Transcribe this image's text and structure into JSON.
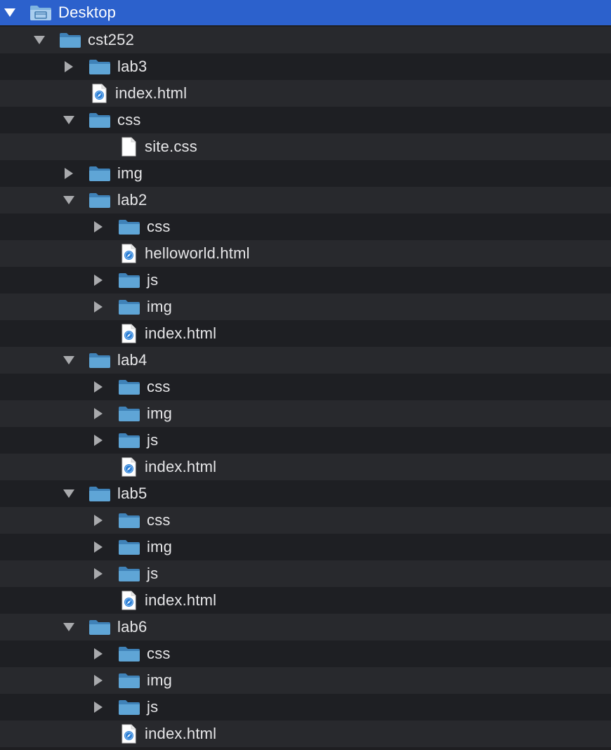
{
  "colors": {
    "selected_row": "#2c61cc",
    "row_odd": "#28292d",
    "row_even": "#1e1f23",
    "text": "#e6e6e8",
    "folder": "#5fa5d6",
    "disclosure": "#a9aaad"
  },
  "tree": [
    {
      "label": "Desktop",
      "depth": 0,
      "type": "desktop-folder",
      "state": "expanded",
      "selected": true
    },
    {
      "label": "cst252",
      "depth": 1,
      "type": "folder",
      "state": "expanded"
    },
    {
      "label": "lab3",
      "depth": 2,
      "type": "folder",
      "state": "collapsed"
    },
    {
      "label": "index.html",
      "depth": 2,
      "type": "html-file",
      "state": "none"
    },
    {
      "label": "css",
      "depth": 2,
      "type": "folder",
      "state": "expanded"
    },
    {
      "label": "site.css",
      "depth": 3,
      "type": "css-file",
      "state": "none"
    },
    {
      "label": "img",
      "depth": 2,
      "type": "folder",
      "state": "collapsed"
    },
    {
      "label": "lab2",
      "depth": 2,
      "type": "folder",
      "state": "expanded"
    },
    {
      "label": "css",
      "depth": 3,
      "type": "folder",
      "state": "collapsed"
    },
    {
      "label": "helloworld.html",
      "depth": 3,
      "type": "html-file",
      "state": "none"
    },
    {
      "label": "js",
      "depth": 3,
      "type": "folder",
      "state": "collapsed"
    },
    {
      "label": "img",
      "depth": 3,
      "type": "folder",
      "state": "collapsed"
    },
    {
      "label": "index.html",
      "depth": 3,
      "type": "html-file",
      "state": "none"
    },
    {
      "label": "lab4",
      "depth": 2,
      "type": "folder",
      "state": "expanded"
    },
    {
      "label": "css",
      "depth": 3,
      "type": "folder",
      "state": "collapsed"
    },
    {
      "label": "img",
      "depth": 3,
      "type": "folder",
      "state": "collapsed"
    },
    {
      "label": "js",
      "depth": 3,
      "type": "folder",
      "state": "collapsed"
    },
    {
      "label": "index.html",
      "depth": 3,
      "type": "html-file",
      "state": "none"
    },
    {
      "label": "lab5",
      "depth": 2,
      "type": "folder",
      "state": "expanded"
    },
    {
      "label": "css",
      "depth": 3,
      "type": "folder",
      "state": "collapsed"
    },
    {
      "label": "img",
      "depth": 3,
      "type": "folder",
      "state": "collapsed"
    },
    {
      "label": "js",
      "depth": 3,
      "type": "folder",
      "state": "collapsed"
    },
    {
      "label": "index.html",
      "depth": 3,
      "type": "html-file",
      "state": "none"
    },
    {
      "label": "lab6",
      "depth": 2,
      "type": "folder",
      "state": "expanded"
    },
    {
      "label": "css",
      "depth": 3,
      "type": "folder",
      "state": "collapsed"
    },
    {
      "label": "img",
      "depth": 3,
      "type": "folder",
      "state": "collapsed"
    },
    {
      "label": "js",
      "depth": 3,
      "type": "folder",
      "state": "collapsed"
    },
    {
      "label": "index.html",
      "depth": 3,
      "type": "html-file",
      "state": "none"
    }
  ]
}
